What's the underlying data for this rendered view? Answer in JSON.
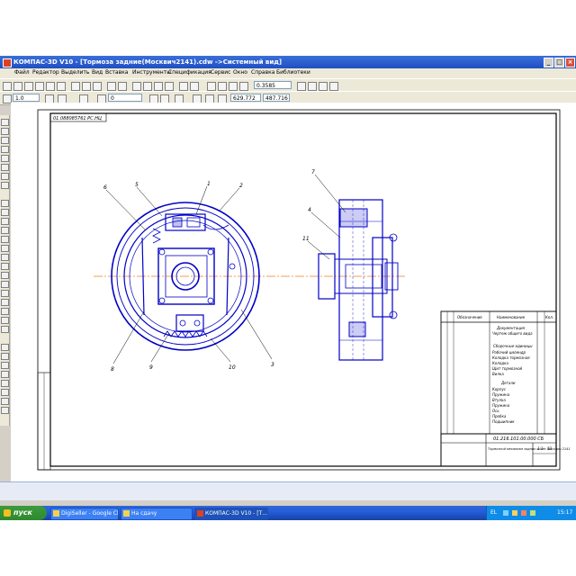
{
  "window": {
    "title": "КОМПАС-3D V10 - [Тормоза задние(Москвич2141).cdw ->Системный вид]"
  },
  "menu": [
    "Файл",
    "Редактор",
    "Выделить",
    "Вид",
    "Вставка",
    "Инструменты",
    "Спецификация",
    "Сервис",
    "Окно",
    "Справка",
    "Библиотеки"
  ],
  "toolbar": {
    "zoom_value": "0.3585",
    "line_style_value": "1.0",
    "layer_value": "0",
    "coord_x": "629.772",
    "coord_y": "487.716"
  },
  "drawing": {
    "stamp_number": "01.088085761 РС.НЦ",
    "callouts_left": [
      "6",
      "5",
      "1",
      "2",
      "3",
      "8",
      "9",
      "10"
    ],
    "callouts_right": [
      "7",
      "4",
      "11"
    ],
    "spec_table": {
      "headers": [
        "Обозначение",
        "Наименование",
        "Кол."
      ],
      "sections": [
        "Документация",
        "Сборочные единицы",
        "Детали"
      ],
      "rows": [
        "Чертеж общего вида",
        "Рабочий цилиндр",
        "Колодка тормозная",
        "Колодка",
        "Щит тормозной",
        "Вилка",
        "Корпус",
        "Пружина",
        "Втулка",
        "Пружина",
        "Ось",
        "Пробка",
        "Подшипник"
      ]
    },
    "title_block": {
      "code": "01.216.101.00.000 СБ",
      "name": "Тормозной механизм задних колёс Москвич 2141",
      "scale": "1:1",
      "sheets": "13"
    }
  },
  "taskbar": {
    "start_label": "пуск",
    "tasks": [
      "DigiSeller - Google Ch...",
      "На сдачу",
      "КОМПАС-3D V10 - [Т..."
    ],
    "lang": "EL",
    "clock": "15:17"
  },
  "colors": {
    "drawing_blue": "#0000c8",
    "axis_orange": "#f08020",
    "titlebar_blue": "#245edb",
    "start_green": "#3c9a3c"
  }
}
